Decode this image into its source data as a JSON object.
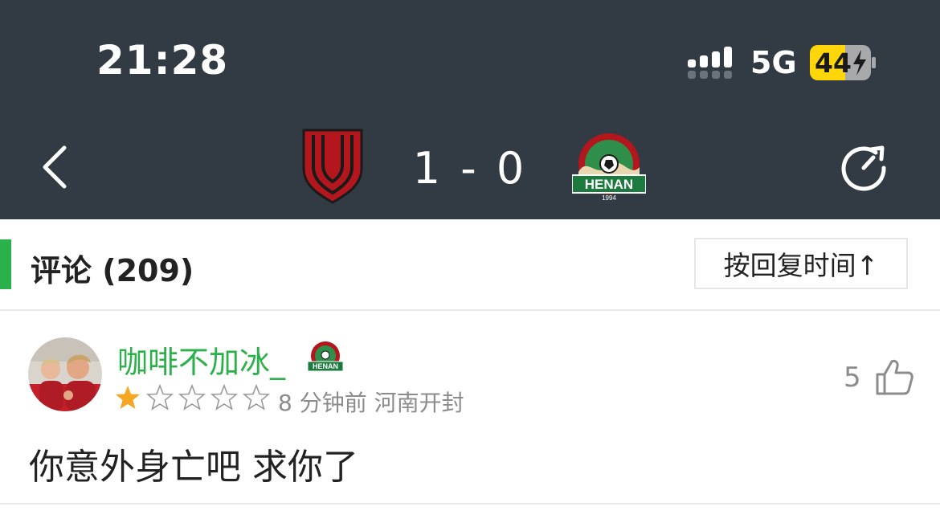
{
  "status_bar": {
    "time": "21:28",
    "network": "5G",
    "battery": "44"
  },
  "match": {
    "score": "1 - 0",
    "away_badge_text": "HENAN",
    "away_badge_year": "1994"
  },
  "comments": {
    "title": "评论 (209)",
    "sort_label": "按回复时间↑"
  },
  "comment": {
    "username": "咖啡不加冰_",
    "badge_text": "HENAN",
    "rating": 1,
    "rating_max": 5,
    "time_ago": "8 分钟前",
    "location": "河南开封",
    "likes": "5",
    "text": "你意外身亡吧 求你了"
  },
  "colors": {
    "header_bg": "#323a44",
    "accent_green": "#2cb04a",
    "star_gold": "#f5a623",
    "battery_yellow": "#ffd60a"
  },
  "icons": [
    "back-chevron-icon",
    "refresh-icon",
    "like-thumb-icon",
    "star-icon",
    "signal-icon",
    "battery-icon"
  ]
}
